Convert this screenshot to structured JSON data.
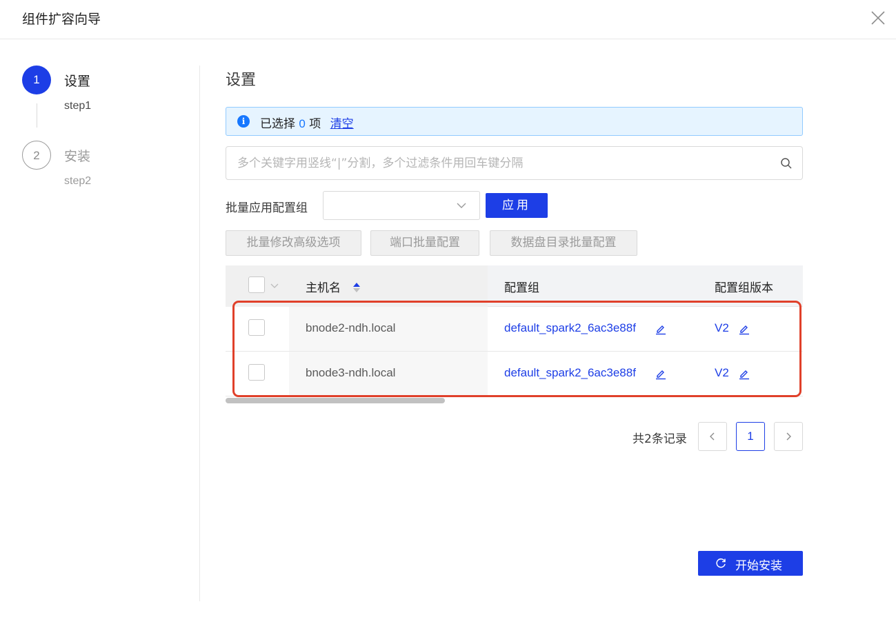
{
  "modal": {
    "title": "组件扩容向导"
  },
  "steps": [
    {
      "number": "1",
      "title": "设置",
      "sub": "step1",
      "status": "active"
    },
    {
      "number": "2",
      "title": "安装",
      "sub": "step2",
      "status": "waiting"
    }
  ],
  "main": {
    "section_title": "设置",
    "alert": {
      "prefix": "已选择",
      "count": "0",
      "suffix": "项",
      "clear": "清空"
    },
    "search": {
      "placeholder": "多个关键字用竖线“|”分割，多个过滤条件用回车键分隔",
      "value": ""
    },
    "batch": {
      "label": "批量应用配置组",
      "select_value": "",
      "apply": "应用"
    },
    "actions": {
      "advanced": "批量修改高级选项",
      "port": "端口批量配置",
      "disk": "数据盘目录批量配置"
    },
    "table": {
      "columns": {
        "host": "主机名",
        "group": "配置组",
        "version": "配置组版本"
      },
      "rows": [
        {
          "host": "bnode2-ndh.local",
          "group": "default_spark2_6ac3e88f",
          "version": "V2"
        },
        {
          "host": "bnode3-ndh.local",
          "group": "default_spark2_6ac3e88f",
          "version": "V2"
        }
      ]
    },
    "pagination": {
      "total": "共2条记录",
      "current": "1",
      "prev": "<",
      "next": ">"
    },
    "install": {
      "label": "开始安装",
      "icon": "refresh-icon"
    }
  },
  "colors": {
    "primary": "#1d3ee6",
    "highlight": "#e0402a",
    "alert_bg": "#e6f4ff"
  }
}
